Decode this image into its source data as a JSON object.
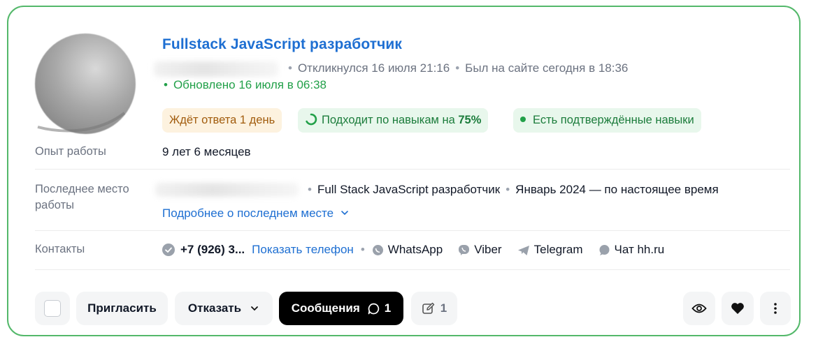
{
  "card": {
    "title": "Fullstack JavaScript разработчик",
    "responded": "Откликнулся 16 июля 21:16",
    "last_seen": "Был на сайте сегодня в 18:36",
    "updated": "Обновлено 16 июля в 06:38",
    "badges": {
      "waiting": "Ждёт ответа 1 день",
      "skills_prefix": "Подходит по навыкам на ",
      "skills_percent": "75%",
      "confirmed": "Есть подтверждённые навыки"
    },
    "experience": {
      "label": "Опыт работы",
      "value": "9 лет 6 месяцев"
    },
    "last_job": {
      "label": "Последнее место работы",
      "position": "Full Stack JavaScript разработчик",
      "period": "Январь 2024 — по настоящее время",
      "more_link": "Подробнее о последнем месте"
    },
    "contacts": {
      "label": "Контакты",
      "phone": "+7 (926) 3...",
      "show_phone": "Показать телефон",
      "whatsapp": "WhatsApp",
      "viber": "Viber",
      "telegram": "Telegram",
      "chat": "Чат hh.ru"
    },
    "actions": {
      "invite": "Пригласить",
      "reject": "Отказать",
      "messages": "Сообщения",
      "messages_count": "1",
      "notes_count": "1"
    },
    "colors": {
      "border": "#53b86a",
      "link": "#1e6fd2",
      "success": "#22a049",
      "wait_bg": "#fdf2df",
      "wait_text": "#a15c0d"
    }
  }
}
